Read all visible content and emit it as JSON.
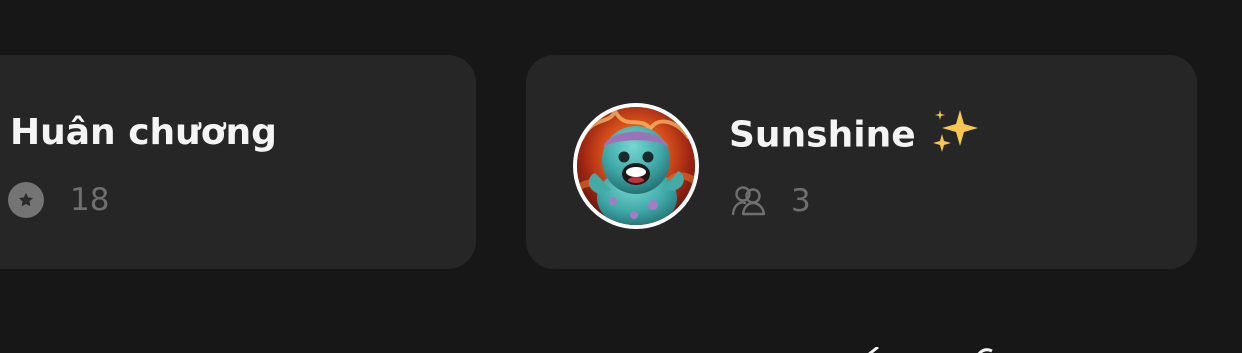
{
  "cards": [
    {
      "title": "Huân chương",
      "count": "18",
      "icon": "star-badge-icon"
    },
    {
      "title": "Sunshine",
      "count": "3",
      "icon": "members-icon",
      "emoji_icon": "sparkles-icon",
      "avatar": "monster-avatar"
    }
  ],
  "colors": {
    "background": "#171717",
    "card": "#262626",
    "title": "#f4f4f4",
    "muted": "#6f6f6f",
    "sparkle": "#f6c64f"
  }
}
